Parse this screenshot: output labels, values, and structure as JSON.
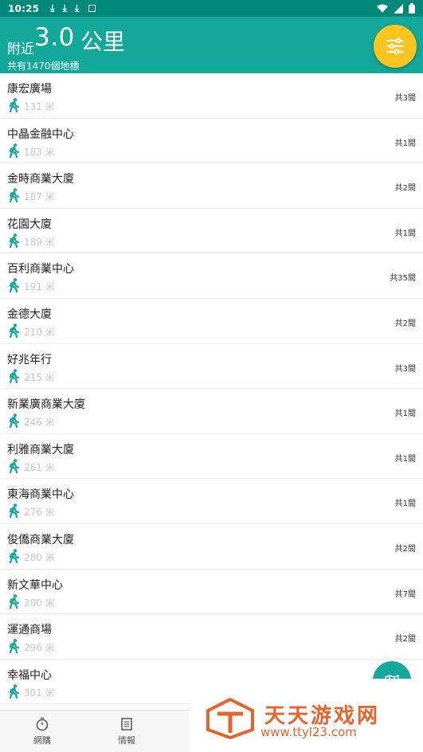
{
  "status_bar": {
    "time": "10:25"
  },
  "header": {
    "near_label": "附近",
    "distance": "3.0",
    "unit": "公里",
    "count_label": "共有1470個地標"
  },
  "icons": {
    "download": "download-icon",
    "image": "image-icon",
    "wifi": "wifi-icon",
    "signal": "signal-icon",
    "battery": "battery-icon",
    "filter": "filter-icon",
    "walk": "walking-person-icon",
    "fab": "map-icon",
    "stopwatch": "stopwatch-icon",
    "news": "newspaper-icon"
  },
  "colors": {
    "primary": "#14a89a",
    "accent": "#fbc521",
    "watermark": "#e8622c"
  },
  "places": [
    {
      "name": "康宏廣場",
      "distance": "131 米",
      "count": "共3間"
    },
    {
      "name": "中晶金融中心",
      "distance": "183 米",
      "count": "共1間"
    },
    {
      "name": "金時商業大廈",
      "distance": "187 米",
      "count": "共2間"
    },
    {
      "name": "花園大廈",
      "distance": "189 米",
      "count": "共1間"
    },
    {
      "name": "百利商業中心",
      "distance": "191 米",
      "count": "共35間"
    },
    {
      "name": "金德大廈",
      "distance": "210 米",
      "count": "共2間"
    },
    {
      "name": "好兆年行",
      "distance": "215 米",
      "count": "共3間"
    },
    {
      "name": "新業廣商業大廈",
      "distance": "246 米",
      "count": "共1間"
    },
    {
      "name": "利雅商業大廈",
      "distance": "261 米",
      "count": "共1間"
    },
    {
      "name": "東海商業中心",
      "distance": "276 米",
      "count": "共1間"
    },
    {
      "name": "俊僑商業大廈",
      "distance": "280 米",
      "count": "共2間"
    },
    {
      "name": "新文華中心",
      "distance": "280 米",
      "count": "共7間"
    },
    {
      "name": "運通商場",
      "distance": "296 米",
      "count": "共2間"
    },
    {
      "name": "幸福中心",
      "distance": "301 米",
      "count": ""
    }
  ],
  "bottom_nav": [
    {
      "label": "網購",
      "icon": "stopwatch-icon"
    },
    {
      "label": "情報",
      "icon": "newspaper-icon"
    }
  ],
  "watermark": {
    "title": "天天游戏网",
    "url": "www.ttyl23.com"
  }
}
